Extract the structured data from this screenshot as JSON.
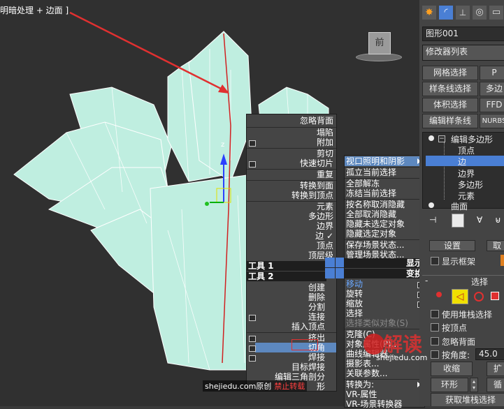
{
  "viewport": {
    "title": "明暗处理 + 边面 ]",
    "viewcube_label": "前",
    "axis_label": "z"
  },
  "quad_menu_left": {
    "items": [
      {
        "label": "忽略背面"
      },
      {
        "label": "塌陷"
      },
      {
        "label": "附加"
      },
      {
        "label": "剪切"
      },
      {
        "label": "快速切片"
      },
      {
        "label": "重复"
      },
      {
        "label": "转换到面"
      },
      {
        "label": "转换到顶点"
      },
      {
        "label": "元素"
      },
      {
        "label": "多边形"
      },
      {
        "label": "边界"
      },
      {
        "label": "边 ✓"
      },
      {
        "label": "顶点"
      },
      {
        "label": "顶层级"
      },
      {
        "label": "创建"
      },
      {
        "label": "删除"
      },
      {
        "label": "分割"
      },
      {
        "label": "连接"
      },
      {
        "label": "插入顶点"
      },
      {
        "label": "挤出"
      },
      {
        "label": "切角"
      },
      {
        "label": "焊接"
      },
      {
        "label": "目标焊接"
      },
      {
        "label": "编辑三角剖分"
      },
      {
        "label": "形"
      }
    ],
    "header_tools1": "工具 1",
    "header_tools2": "工具 2"
  },
  "quad_menu_right": {
    "items": [
      {
        "label": "视口照明和阴影"
      },
      {
        "label": "孤立当前选择"
      },
      {
        "label": "全部解冻"
      },
      {
        "label": "冻结当前选择"
      },
      {
        "label": "按名称取消隐藏"
      },
      {
        "label": "全部取消隐藏"
      },
      {
        "label": "隐藏未选定对象"
      },
      {
        "label": "隐藏选定对象"
      },
      {
        "label": "保存场景状态..."
      },
      {
        "label": "管理场景状态..."
      },
      {
        "label": "移动"
      },
      {
        "label": "旋转"
      },
      {
        "label": "缩放"
      },
      {
        "label": "选择"
      },
      {
        "label": "选择类似对象(S)"
      },
      {
        "label": "克隆(C)"
      },
      {
        "label": "对象属性(P)..."
      },
      {
        "label": "曲线编辑器..."
      },
      {
        "label": "摄影表..."
      },
      {
        "label": "关联参数..."
      },
      {
        "label": "转换为:"
      },
      {
        "label": "VR-属性"
      },
      {
        "label": "VR-场景转换器"
      }
    ],
    "header_display": "显示",
    "header_transform": "变换"
  },
  "command_panel": {
    "object_name": "图形001",
    "modifier_list": "修改器列表",
    "buttons": {
      "mesh_select": "网格选择",
      "p_btn": "P",
      "spline_select": "样条线选择",
      "poly_btn": "多边",
      "volume_select": "体积选择",
      "ffd_btn": "FFD",
      "edit_spline": "编辑样条线",
      "nurbs_btn": "NURBS"
    },
    "stack": {
      "edit_poly": "编辑多边形",
      "vertex": "顶点",
      "edge": "边",
      "border": "边界",
      "polygon": "多边形",
      "element": "元素",
      "surface": "曲面"
    },
    "reset_btn": "设置",
    "show_cage": "显示框架",
    "selection_rollout": "选择",
    "use_stack_selection": "使用堆栈选择",
    "by_vertex": "按顶点",
    "ignore_backfacing": "忽略背面",
    "by_angle": "按角度:",
    "angle_value": "45.0",
    "shrink": "收缩",
    "grow_partial": "扩",
    "ring": "环形",
    "loop_partial": "循",
    "get_stack_selection": "获取堆栈选择",
    "mini_btn": "取"
  },
  "watermark": {
    "site": "shejiedu.com原创",
    "forbid": "禁止转载",
    "logo_text": "解读",
    "logo_url": "shejiedu.com"
  },
  "colors": {
    "highlight": "#5d88bf",
    "model": "#bfeee0",
    "arrow": "#e03030"
  }
}
